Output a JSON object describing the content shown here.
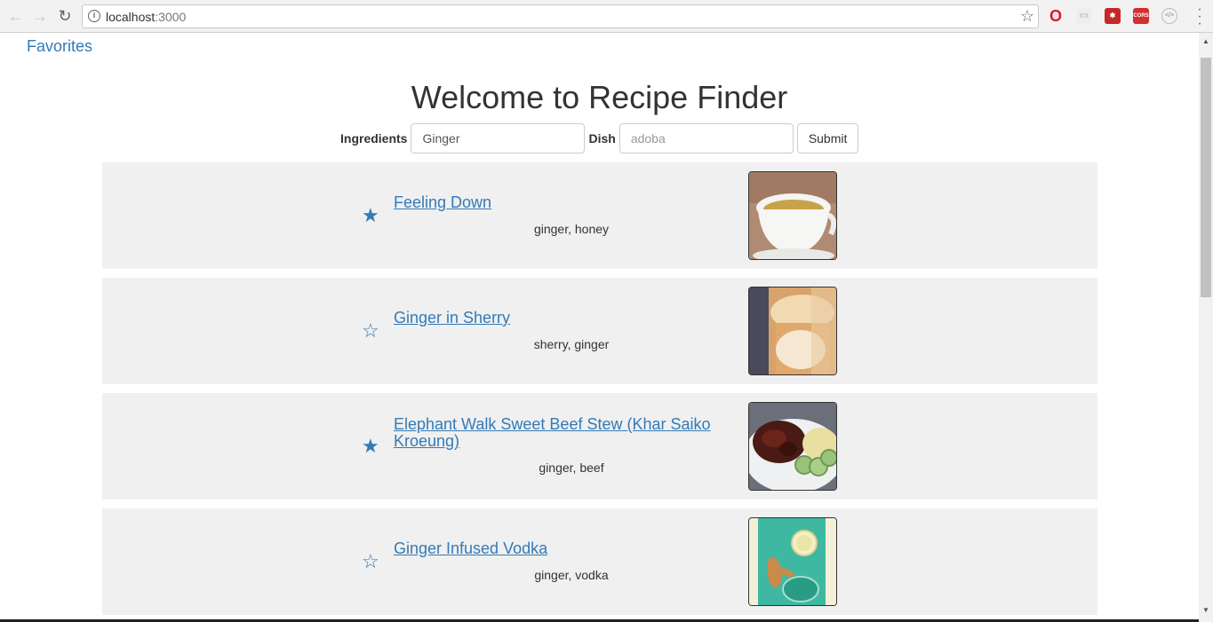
{
  "browser": {
    "url_host": "localhost",
    "url_port": ":3000",
    "back_glyph": "←",
    "forward_glyph": "→",
    "reload_glyph": "↻",
    "bookmark_glyph": "☆",
    "info_glyph": "i",
    "extensions": [
      {
        "name": "opera-icon",
        "label": "O",
        "color": "#e0171f"
      },
      {
        "name": "ex-icon",
        "label": "ex",
        "color": "#e5e5e5"
      },
      {
        "name": "extension-red-icon",
        "label": "✱",
        "color": "#c62828"
      },
      {
        "name": "cors-icon",
        "label": "CORS",
        "color": "#d32f2f"
      },
      {
        "name": "code-icon",
        "label": "</>",
        "color": "#9e9e9e"
      }
    ]
  },
  "nav": {
    "favorites": "Favorites"
  },
  "title": "Welcome to Recipe Finder",
  "search": {
    "ingredients_label": "Ingredients",
    "ingredients_value": "Ginger",
    "dish_label": "Dish",
    "dish_placeholder": "adoba",
    "submit_label": "Submit"
  },
  "recipes": [
    {
      "title": "Feeling Down",
      "ingredients": "ginger, honey",
      "favorited": true,
      "star": "★",
      "image": "tea-cup"
    },
    {
      "title": "Ginger in Sherry",
      "ingredients": "sherry, ginger",
      "favorited": false,
      "star": "☆",
      "image": "sherry-glass"
    },
    {
      "title": "Elephant Walk Sweet Beef Stew (Khar Saiko Kroeung)",
      "ingredients": "ginger, beef",
      "favorited": true,
      "star": "★",
      "image": "beef-stew-plate"
    },
    {
      "title": "Ginger Infused Vodka",
      "ingredients": "ginger, vodka",
      "favorited": false,
      "star": "☆",
      "image": "ginger-vodka"
    }
  ]
}
